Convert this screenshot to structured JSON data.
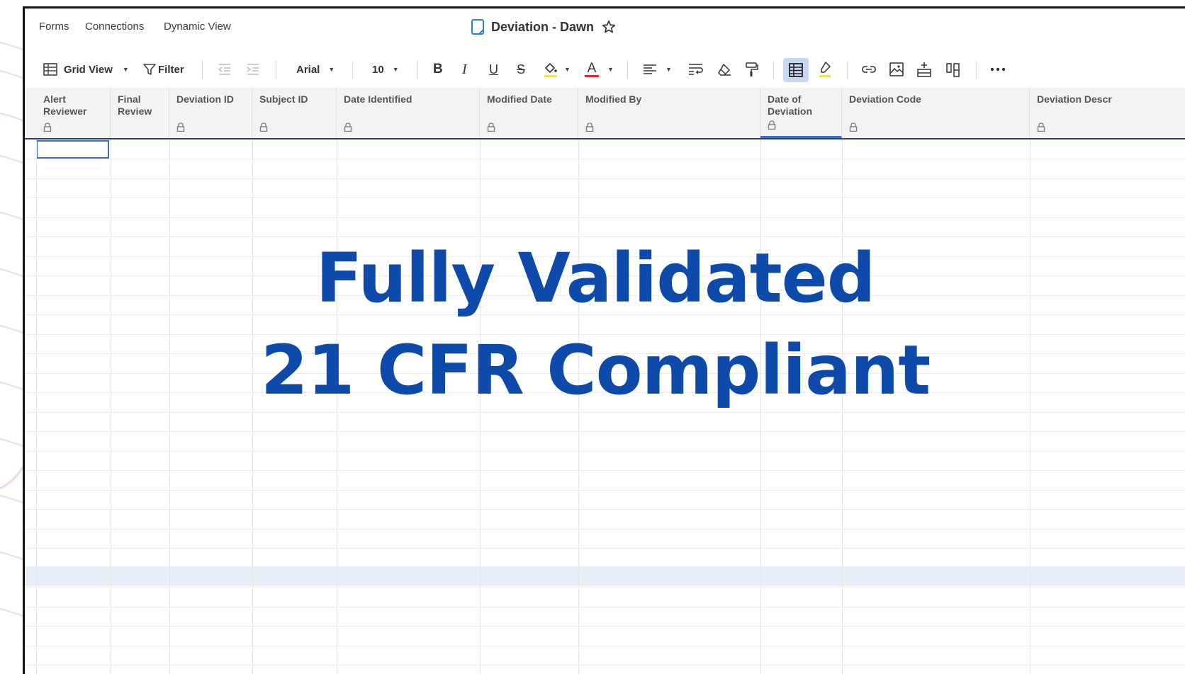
{
  "nav": {
    "forms": "Forms",
    "connections": "Connections",
    "dynamic_view": "Dynamic View"
  },
  "document": {
    "title": "Deviation - Dawn",
    "icon": "sheet-icon",
    "favorite_icon": "star-icon"
  },
  "toolbar": {
    "view": "Grid View",
    "filter": "Filter",
    "font": "Arial",
    "font_size": "10",
    "bold": "B",
    "italic": "I",
    "underline": "U",
    "strike": "S",
    "text_color_glyph": "A"
  },
  "columns": [
    {
      "label": "Alert\nReviewer"
    },
    {
      "label": "Final\nReview"
    },
    {
      "label": "Deviation ID"
    },
    {
      "label": "Subject ID"
    },
    {
      "label": "Date Identified"
    },
    {
      "label": "Modified Date"
    },
    {
      "label": "Modified By"
    },
    {
      "label": "Date of\nDeviation"
    },
    {
      "label": "Deviation Code"
    },
    {
      "label": "Deviation Descr"
    }
  ],
  "overlay": {
    "line1": "Fully Validated",
    "line2": "21 CFR Compliant"
  },
  "colors": {
    "accent": "#0d4aa9",
    "selection": "#3d6fc4",
    "header_bg": "#f3f3f3"
  }
}
